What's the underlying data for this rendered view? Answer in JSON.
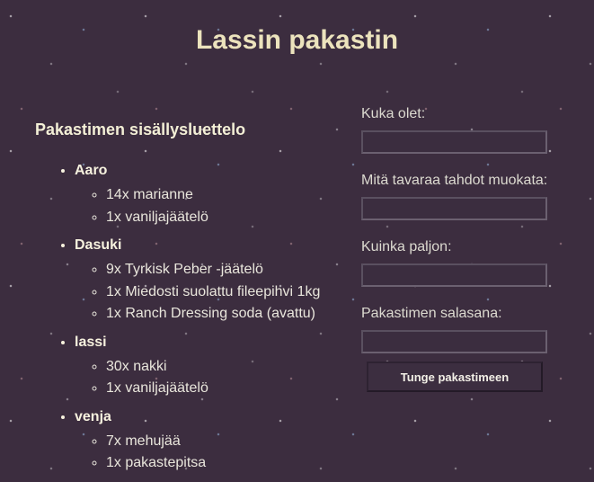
{
  "page": {
    "title": "Lassin pakastin"
  },
  "inventory": {
    "heading": "Pakastimen sisällysluettelo",
    "owners": [
      {
        "name": "Aaro",
        "items": [
          "14x marianne",
          "1x vaniljajäätelö"
        ]
      },
      {
        "name": "Dasuki",
        "items": [
          "9x Tyrkisk Peber -jäätelö",
          "1x Miedosti suolattu fileepihvi 1kg",
          "1x Ranch Dressing soda (avattu)"
        ]
      },
      {
        "name": "lassi",
        "items": [
          "30x nakki",
          "1x vaniljajäätelö"
        ]
      },
      {
        "name": "venja",
        "items": [
          "7x mehujää",
          "1x pakastepitsa"
        ]
      }
    ]
  },
  "form": {
    "who_label": "Kuka olet:",
    "who_value": "",
    "item_label": "Mitä tavaraa tahdot muokata:",
    "item_value": "",
    "amount_label": "Kuinka paljon:",
    "amount_value": "",
    "password_label": "Pakastimen salasana:",
    "password_value": "",
    "submit_label": "Tunge pakastimeen"
  },
  "colors": {
    "background": "#3c2d3f",
    "title": "#ece3bd",
    "text": "#f1f1e6"
  }
}
